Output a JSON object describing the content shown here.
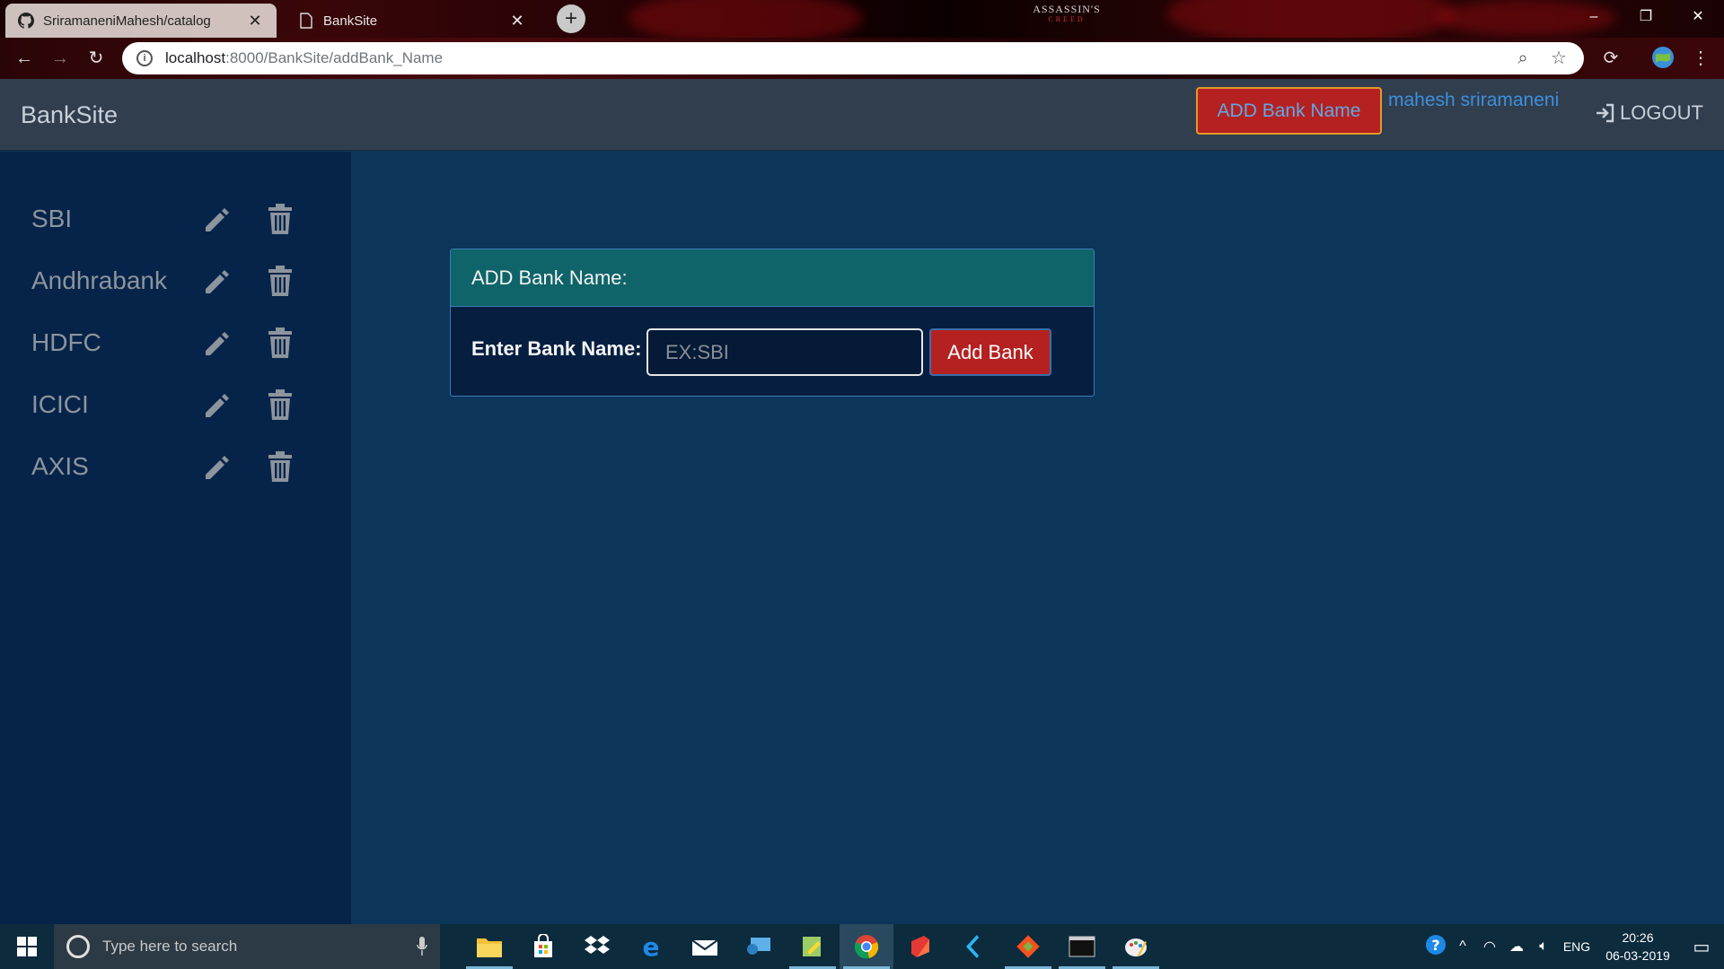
{
  "browser": {
    "tabs": [
      {
        "title": "SriramaneniMahesh/catalog",
        "icon": "github-icon",
        "active": true
      },
      {
        "title": "BankSite",
        "icon": "document-icon",
        "active": false
      }
    ],
    "tab_close": "✕",
    "new_tab": "+",
    "wallpaper_logo": "ASSASSIN'S",
    "wallpaper_logo_sub": "CREED",
    "url_host": "localhost",
    "url_path": ":8000/BankSite/addBank_Name",
    "window_controls": {
      "minimize": "–",
      "maximize": "❐",
      "close": "✕"
    }
  },
  "navbar": {
    "brand": "BankSite",
    "add_button": "ADD Bank Name",
    "user": "mahesh sriramaneni",
    "logout": "LOGOUT"
  },
  "sidebar": {
    "banks": [
      {
        "name": "SBI"
      },
      {
        "name": "Andhrabank"
      },
      {
        "name": "HDFC"
      },
      {
        "name": "ICICI"
      },
      {
        "name": "AXIS"
      }
    ]
  },
  "form": {
    "header": "ADD Bank Name:",
    "label": "Enter Bank Name:",
    "placeholder": "EX:SBI",
    "value": "",
    "submit": "Add Bank"
  },
  "taskbar": {
    "search_placeholder": "Type here to search",
    "apps": [
      "file-explorer",
      "store",
      "dropbox",
      "edge",
      "mail",
      "remote-desktop",
      "notepad-plus",
      "chrome",
      "office",
      "visual-studio-code",
      "git",
      "terminal",
      "paint"
    ],
    "active_app": "chrome",
    "language": "ENG",
    "time": "20:26",
    "date": "06-03-2019"
  },
  "colors": {
    "page_bg": "#0c355a",
    "sidebar_bg": "#062449",
    "navbar_bg": "#303e4e",
    "card_header_bg": "#0e6469",
    "button_red": "#b52121",
    "user_link": "#3f8fdc"
  }
}
